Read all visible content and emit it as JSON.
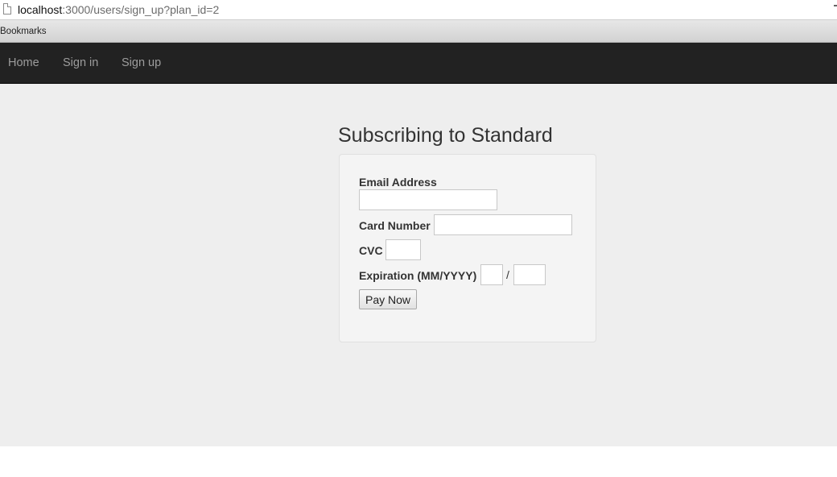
{
  "browser": {
    "url_host": "localhost",
    "url_path": ":3000/users/sign_up?plan_id=2",
    "bookmarks_label": "Bookmarks"
  },
  "navbar": {
    "links": [
      {
        "label": "Home"
      },
      {
        "label": "Sign in"
      },
      {
        "label": "Sign up"
      }
    ],
    "background": "#222222",
    "link_color": "#9d9d9d"
  },
  "page": {
    "title": "Subscribing to Standard",
    "background": "#eeeeee"
  },
  "form": {
    "email_label": "Email Address",
    "email_value": "",
    "card_number_label": "Card Number",
    "card_number_value": "",
    "cvc_label": "CVC",
    "cvc_value": "",
    "expiration_label": "Expiration (MM/YYYY)",
    "exp_month_value": "",
    "exp_separator": "/",
    "exp_year_value": "",
    "submit_label": "Pay Now"
  }
}
